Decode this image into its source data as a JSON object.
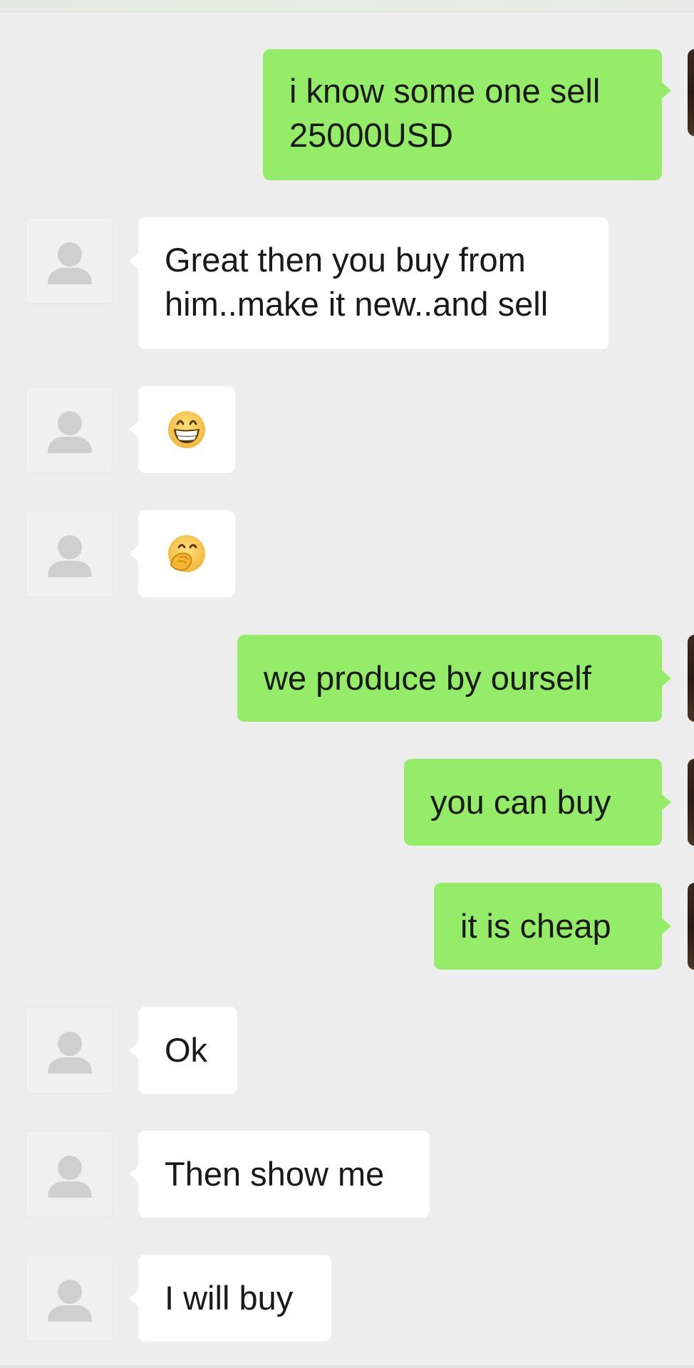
{
  "chat": {
    "messages": [
      {
        "side": "sent",
        "lines": [
          "i know some one sell",
          "25000USD"
        ]
      },
      {
        "side": "received",
        "lines": [
          "Great then you buy from",
          "him..make it new..and sell"
        ]
      },
      {
        "side": "received",
        "emoji": "grinning-face-icon"
      },
      {
        "side": "received",
        "emoji": "face-with-hand-over-mouth-icon"
      },
      {
        "side": "sent",
        "lines": [
          "we produce by ourself"
        ]
      },
      {
        "side": "sent",
        "lines": [
          "you can buy"
        ]
      },
      {
        "side": "sent",
        "lines": [
          "it is cheap"
        ]
      },
      {
        "side": "received",
        "lines": [
          "Ok"
        ]
      },
      {
        "side": "received",
        "lines": [
          "Then show me"
        ]
      },
      {
        "side": "received",
        "lines": [
          "I will buy"
        ]
      }
    ]
  },
  "colors": {
    "background": "#ededed",
    "sent_bubble": "#95ec69",
    "received_bubble": "#ffffff",
    "text": "#191919",
    "emoji_yellow": "#f7c73c"
  }
}
